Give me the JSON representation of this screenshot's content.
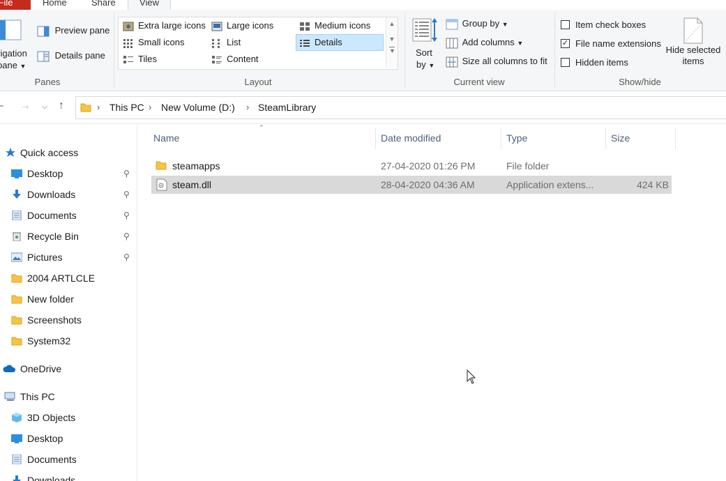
{
  "ribbon_tabs": [
    "File",
    "Home",
    "Share",
    "View"
  ],
  "panes_group": {
    "label": "Panes",
    "navigation_pane_label_line1": "vigation",
    "navigation_pane_label_line2": "pane",
    "preview_pane": "Preview pane",
    "details_pane": "Details pane"
  },
  "layout_group": {
    "label": "Layout",
    "items": [
      "Extra large icons",
      "Large icons",
      "Medium icons",
      "Small icons",
      "List",
      "Details",
      "Tiles",
      "Content"
    ],
    "selected": "Details"
  },
  "current_view_group": {
    "label": "Current view",
    "sort_by_line1": "Sort",
    "sort_by_line2": "by",
    "group_by": "Group by",
    "add_columns": "Add columns",
    "size_all_columns": "Size all columns to fit"
  },
  "showhide_group": {
    "label": "Show/hide",
    "item_check_boxes": "Item check boxes",
    "item_check_boxes_checked": false,
    "file_name_extensions": "File name extensions",
    "file_name_extensions_checked": true,
    "hidden_items": "Hidden items",
    "hidden_items_checked": false,
    "hide_selected_line1": "Hide selected",
    "hide_selected_line2": "items"
  },
  "breadcrumb": [
    "This PC",
    "New Volume (D:)",
    "SteamLibrary"
  ],
  "nav_pane": {
    "quick_access": "Quick access",
    "quick_items": [
      {
        "label": "Desktop",
        "pinned": true
      },
      {
        "label": "Downloads",
        "pinned": true
      },
      {
        "label": "Documents",
        "pinned": true
      },
      {
        "label": "Recycle Bin",
        "pinned": true
      },
      {
        "label": "Pictures",
        "pinned": true
      },
      {
        "label": "2004 ARTLCLE",
        "pinned": false
      },
      {
        "label": "New folder",
        "pinned": false
      },
      {
        "label": "Screenshots",
        "pinned": false
      },
      {
        "label": "System32",
        "pinned": false
      }
    ],
    "onedrive": "OneDrive",
    "this_pc": "This PC",
    "pc_items": [
      "3D Objects",
      "Desktop",
      "Documents",
      "Downloads"
    ]
  },
  "columns": [
    "Name",
    "Date modified",
    "Type",
    "Size"
  ],
  "files": [
    {
      "name": "steamapps",
      "date": "27-04-2020 01:26 PM",
      "type": "File folder",
      "size": "",
      "kind": "folder",
      "selected": false
    },
    {
      "name": "steam.dll",
      "date": "28-04-2020 04:36 AM",
      "type": "Application extens...",
      "size": "424 KB",
      "kind": "dll",
      "selected": true
    }
  ],
  "colors": {
    "file_tab": "#c42b1c",
    "selection": "#d9d9d9",
    "folder": "#f4c542",
    "accent": "#0078d7"
  }
}
